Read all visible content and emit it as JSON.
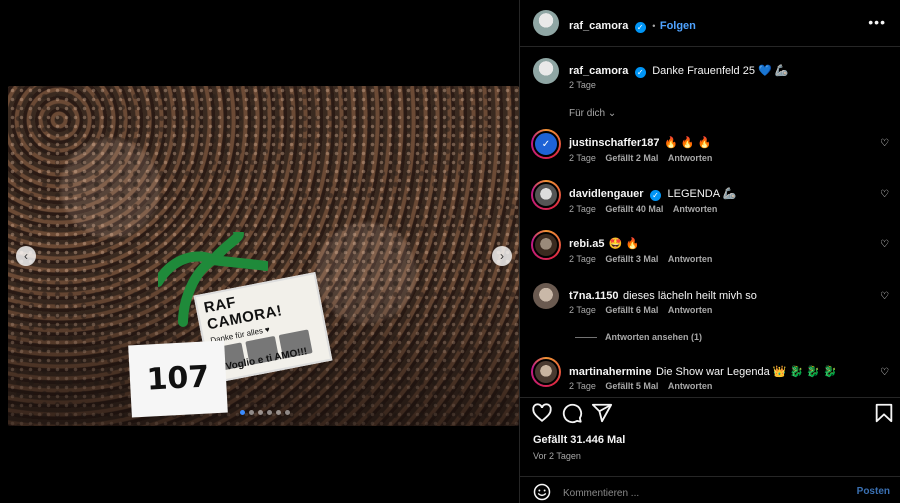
{
  "header": {
    "username": "raf_camora",
    "follow_label": "Folgen",
    "more_label": "•••"
  },
  "caption": {
    "username": "raf_camora",
    "text": "Danke Frauenfeld 25 💙 🦾",
    "time": "2 Tage"
  },
  "photo": {
    "sign_title": "RAF CAMORA!",
    "sign_line": "Danke für alles ♥",
    "sign_bottom": "¡ Voglio e ti AMO!!!",
    "jersey_number": "107"
  },
  "sort_label": "Für dich ⌄",
  "comments": [
    {
      "username": "justinschaffer187",
      "verified": false,
      "text": "🔥 🔥 🔥",
      "time": "2 Tage",
      "likes": "Gefällt 2 Mal",
      "reply": "Antworten"
    },
    {
      "username": "davidlengauer",
      "verified": true,
      "text": "LEGENDA 🦾",
      "time": "2 Tage",
      "likes": "Gefällt 40 Mal",
      "reply": "Antworten"
    },
    {
      "username": "rebi.a5",
      "verified": false,
      "text": "🤩 🔥",
      "time": "2 Tage",
      "likes": "Gefällt 3 Mal",
      "reply": "Antworten"
    },
    {
      "username": "t7na.1150",
      "verified": false,
      "text": "dieses lächeln heilt mivh so",
      "time": "2 Tage",
      "likes": "Gefällt 6 Mal",
      "reply": "Antworten"
    },
    {
      "username": "martinahermine",
      "verified": false,
      "text": "Die Show war Legenda 👑 🐉 🐉 🐉",
      "time": "2 Tage",
      "likes": "Gefällt 5 Mal",
      "reply": "Antworten"
    }
  ],
  "view_replies": "Antworten ansehen (1)",
  "likes_total": "Gefällt 31.446 Mal",
  "posted_ago": "Vor 2 Tagen",
  "comment_placeholder": "Kommentieren ...",
  "post_label": "Posten",
  "icons": {
    "like": "heart-icon",
    "comment": "comment-icon",
    "share": "send-icon",
    "save": "bookmark-icon",
    "emoji": "emoji-icon"
  },
  "colors": {
    "accent": "#0095f6",
    "follow": "#4fa3ff",
    "muted": "#a8a8a8"
  }
}
